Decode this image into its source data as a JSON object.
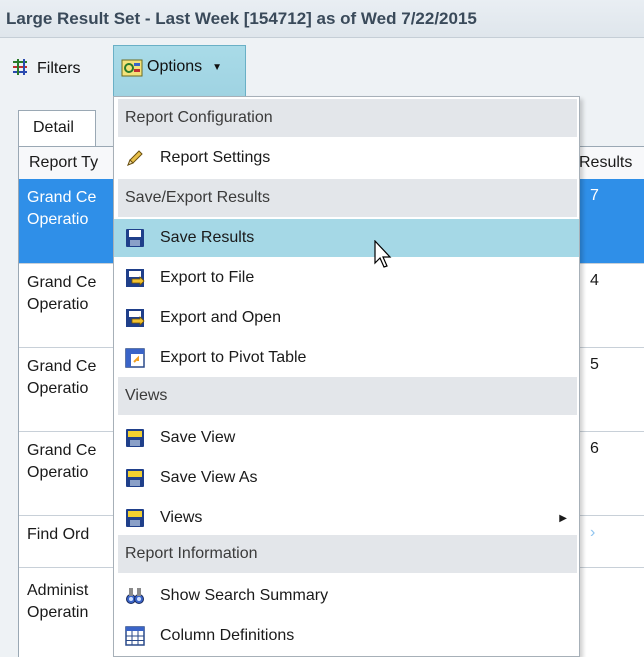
{
  "window": {
    "title": "Large Result Set - Last Week [154712] as of Wed 7/22/2015"
  },
  "toolbar": {
    "filters_label": "Filters",
    "options_label": "Options"
  },
  "tabs": [
    {
      "label": "Detail"
    }
  ],
  "grid": {
    "columns": [
      "Report Ty",
      "Results"
    ],
    "rows": [
      {
        "line1": "Grand Ce",
        "line2": "Operatio",
        "result": "7",
        "selected": true
      },
      {
        "line1": "Grand Ce",
        "line2": "Operatio",
        "result": "4",
        "selected": false
      },
      {
        "line1": "Grand Ce",
        "line2": "Operatio",
        "result": "5",
        "selected": false
      },
      {
        "line1": "Grand Ce",
        "line2": "Operatio",
        "result": "6",
        "selected": false
      },
      {
        "line1": "Find Ord",
        "line2": "",
        "result": "",
        "selected": false
      },
      {
        "line1": "Administ",
        "line2": "Operatin",
        "result": "",
        "selected": false
      }
    ]
  },
  "menu": {
    "items": [
      {
        "kind": "section",
        "label": "Report Configuration"
      },
      {
        "kind": "item",
        "label": "Report Settings",
        "icon": "pencil-icon"
      },
      {
        "kind": "section",
        "label": "Save/Export Results"
      },
      {
        "kind": "item",
        "label": "Save Results",
        "icon": "floppy-disk-icon",
        "active": true
      },
      {
        "kind": "item",
        "label": "Export to File",
        "icon": "export-icon"
      },
      {
        "kind": "item",
        "label": "Export and Open",
        "icon": "export-icon"
      },
      {
        "kind": "item",
        "label": "Export to Pivot Table",
        "icon": "pivot-table-icon"
      },
      {
        "kind": "section",
        "label": "Views"
      },
      {
        "kind": "item",
        "label": "Save View",
        "icon": "save-view-icon"
      },
      {
        "kind": "item",
        "label": "Save View As",
        "icon": "save-view-icon"
      },
      {
        "kind": "item",
        "label": "Views",
        "icon": "save-view-icon",
        "submenu": true
      },
      {
        "kind": "section",
        "label": "Report Information"
      },
      {
        "kind": "item",
        "label": "Show Search Summary",
        "icon": "binoculars-icon"
      },
      {
        "kind": "item",
        "label": "Column Definitions",
        "icon": "table-icon"
      }
    ]
  },
  "colors": {
    "selected_row": "#2f8fe8",
    "menu_hover": "#a5d8e6",
    "options_button": "#a9dbe8"
  }
}
